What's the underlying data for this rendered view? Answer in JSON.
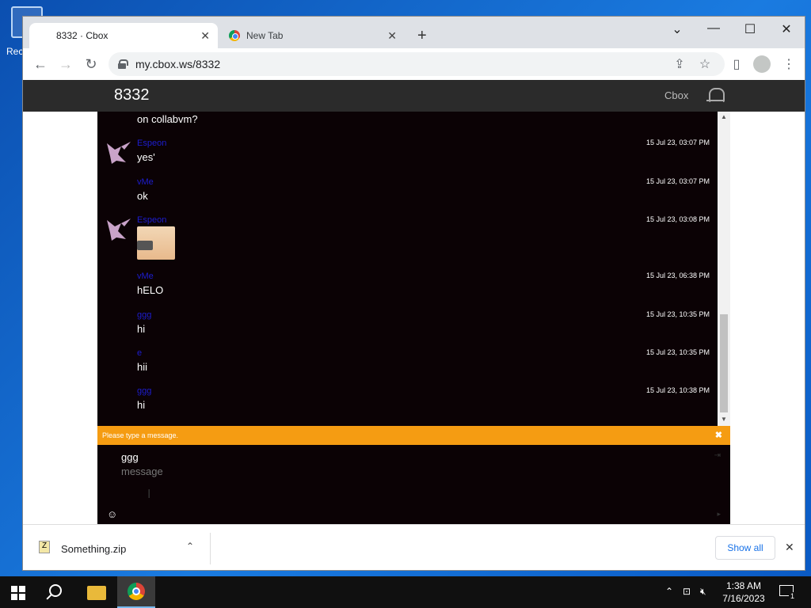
{
  "desktop": {
    "recycle_label": "Rec"
  },
  "browser": {
    "tabs": [
      {
        "title": "8332 · Cbox",
        "active": true
      },
      {
        "title": "New Tab",
        "active": false
      }
    ],
    "new_tab_symbol": "+",
    "address": "my.cbox.ws/8332",
    "controls": {
      "minimize": "—",
      "maximize": "☐",
      "close": "✕",
      "tab_search": "⌄"
    }
  },
  "site": {
    "title": "8332",
    "brand": "Cbox"
  },
  "chat": {
    "messages": [
      {
        "user": "",
        "text": "on collabvm?",
        "time": ""
      },
      {
        "user": "Espeon",
        "text": "yes'",
        "time": "15 Jul 23, 03:07 PM",
        "avatar": true
      },
      {
        "user": "vMe",
        "text": "ok",
        "time": "15 Jul 23, 03:07 PM"
      },
      {
        "user": "Espeon",
        "text": "",
        "time": "15 Jul 23, 03:08 PM",
        "avatar": true,
        "image": "cat-with-gun"
      },
      {
        "user": "vMe",
        "text": "hELO",
        "time": "15 Jul 23, 06:38 PM"
      },
      {
        "user": "ggg",
        "text": "hi",
        "time": "15 Jul 23, 10:35 PM"
      },
      {
        "user": "e",
        "text": "hii",
        "time": "15 Jul 23, 10:35 PM"
      },
      {
        "user": "ggg",
        "text": "hi",
        "time": "15 Jul 23, 10:38 PM"
      }
    ],
    "notice": "Please type a message.",
    "compose": {
      "name_value": "ggg",
      "message_placeholder": "message"
    }
  },
  "downloads": {
    "file_name": "Something.zip",
    "show_all_label": "Show all"
  },
  "taskbar": {
    "time": "1:38 AM",
    "date": "7/16/2023",
    "notification_count": "1"
  },
  "colors": {
    "chat_bg": "#0b0205",
    "notice_bar": "#f59c12",
    "username": "#1d1dcf",
    "header_bg": "#2b2b2b"
  }
}
